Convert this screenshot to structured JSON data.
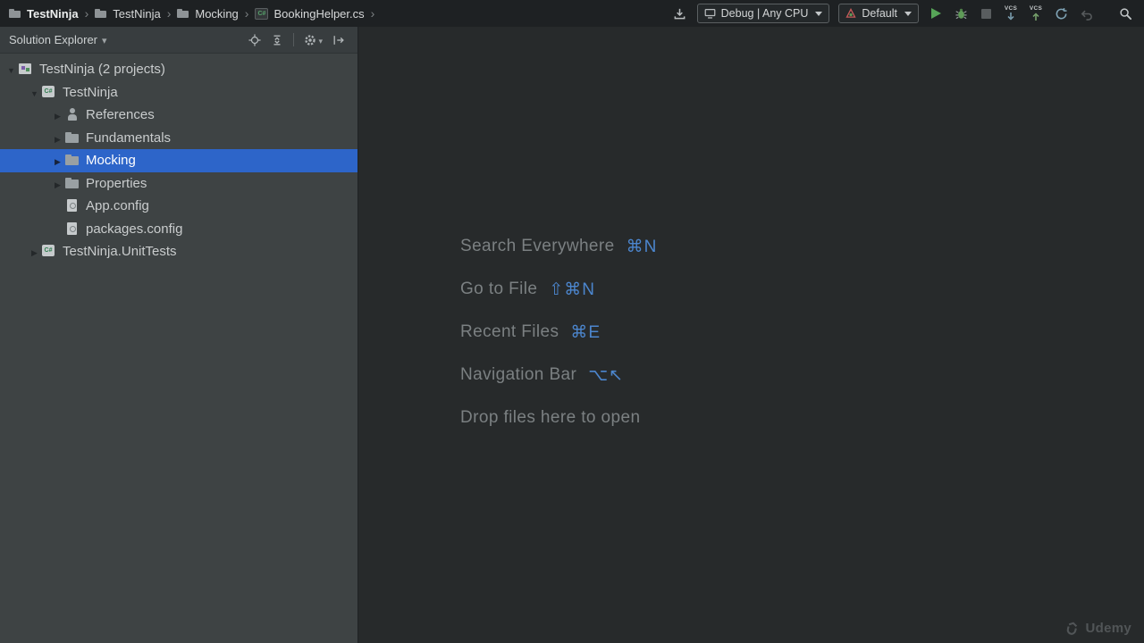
{
  "titlebar": {
    "breadcrumbs": [
      "TestNinja",
      "TestNinja",
      "Mocking",
      "BookingHelper.cs"
    ],
    "separator": "›",
    "run_config_label": "Debug | Any CPU",
    "profile_label": "Default",
    "vcs_label": "VCS"
  },
  "solution_explorer": {
    "title": "Solution Explorer",
    "items": [
      {
        "label": "TestNinja (2 projects)",
        "level": 0,
        "state": "expanded",
        "icon": "solution-icon"
      },
      {
        "label": "TestNinja",
        "level": 1,
        "state": "expanded",
        "icon": "csharp-project-icon"
      },
      {
        "label": "References",
        "level": 2,
        "state": "collapsed",
        "icon": "references-icon"
      },
      {
        "label": "Fundamentals",
        "level": 2,
        "state": "collapsed",
        "icon": "folder-icon"
      },
      {
        "label": "Mocking",
        "level": 2,
        "state": "collapsed",
        "icon": "folder-icon",
        "selected": true
      },
      {
        "label": "Properties",
        "level": 2,
        "state": "collapsed",
        "icon": "folder-icon"
      },
      {
        "label": "App.config",
        "level": 2,
        "state": "leaf",
        "icon": "config-file-icon"
      },
      {
        "label": "packages.config",
        "level": 2,
        "state": "leaf",
        "icon": "config-file-icon"
      },
      {
        "label": "TestNinja.UnitTests",
        "level": 1,
        "state": "collapsed",
        "icon": "csharp-project-icon"
      }
    ]
  },
  "editor": {
    "shortcuts": [
      {
        "label": "Search Everywhere",
        "keys": "⌘N"
      },
      {
        "label": "Go to File",
        "keys": "⇧⌘N"
      },
      {
        "label": "Recent Files",
        "keys": "⌘E"
      },
      {
        "label": "Navigation Bar",
        "keys": "⌥↖"
      },
      {
        "label": "Drop files here to open",
        "keys": ""
      }
    ],
    "watermark": "Udemy"
  },
  "colors": {
    "selection_blue": "#2d65c9",
    "shortcut_key_blue": "#4c86ce",
    "run_green": "#57a558",
    "titlebar_bg": "#1e2123",
    "sidebar_bg": "#3e4344",
    "editor_bg": "#272a2b"
  }
}
